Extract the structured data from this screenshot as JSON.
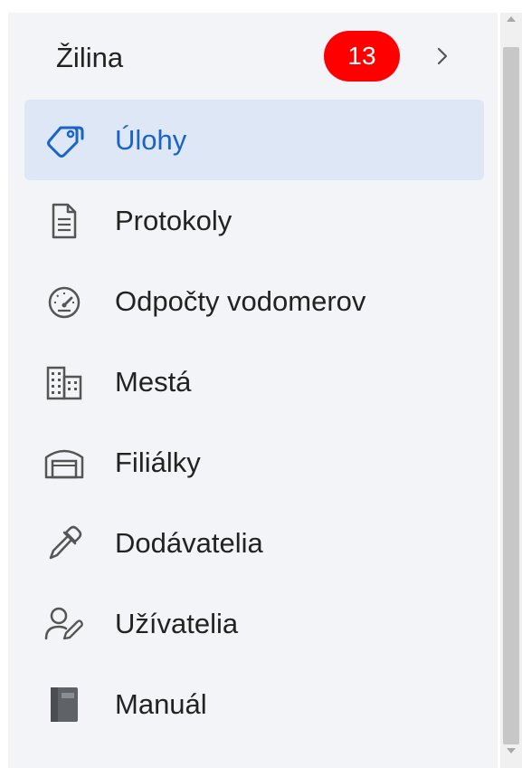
{
  "header": {
    "title": "Žilina",
    "badge_count": "13",
    "expand_icon": "chevron-right-icon"
  },
  "colors": {
    "badge": "#ff0000",
    "active_bg": "#dde7f6",
    "active_text": "#1a63c9",
    "panel_bg": "#f3f4f7"
  },
  "menu": {
    "items": [
      {
        "label": "Úlohy",
        "icon": "tag-icon",
        "active": true
      },
      {
        "label": "Protokoly",
        "icon": "document-icon",
        "active": false
      },
      {
        "label": "Odpočty vodomerov",
        "icon": "gauge-icon",
        "active": false
      },
      {
        "label": "Mestá",
        "icon": "buildings-icon",
        "active": false
      },
      {
        "label": "Filiálky",
        "icon": "garage-icon",
        "active": false
      },
      {
        "label": "Dodávatelia",
        "icon": "eyedropper-icon",
        "active": false
      },
      {
        "label": "Užívatelia",
        "icon": "user-edit-icon",
        "active": false
      },
      {
        "label": "Manuál",
        "icon": "book-icon",
        "active": false
      }
    ]
  }
}
